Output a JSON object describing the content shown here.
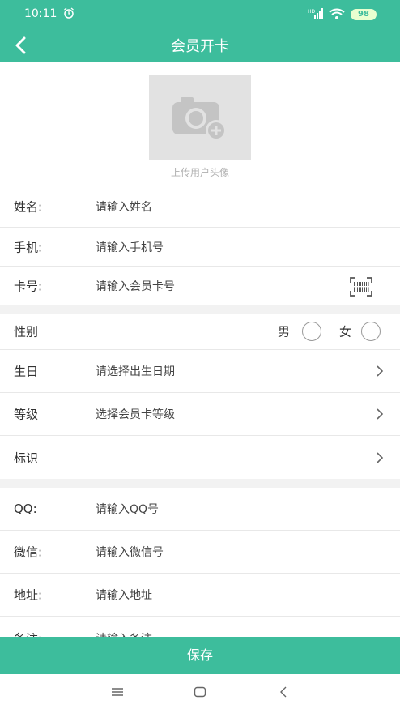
{
  "status": {
    "time": "10:11",
    "signal": "HD",
    "battery": "98"
  },
  "header": {
    "title": "会员开卡"
  },
  "avatar": {
    "caption": "上传用户头像"
  },
  "fields": {
    "name": {
      "label": "姓名:",
      "placeholder": "请输入姓名"
    },
    "phone": {
      "label": "手机:",
      "placeholder": "请输入手机号"
    },
    "card": {
      "label": "卡号:",
      "placeholder": "请输入会员卡号"
    },
    "gender": {
      "label": "性别",
      "male": "男",
      "female": "女"
    },
    "birthday": {
      "label": "生日",
      "placeholder": "请选择出生日期"
    },
    "level": {
      "label": "等级",
      "placeholder": "选择会员卡等级"
    },
    "tag": {
      "label": "标识",
      "placeholder": ""
    },
    "qq": {
      "label": "QQ:",
      "placeholder": "请输入QQ号"
    },
    "wechat": {
      "label": "微信:",
      "placeholder": "请输入微信号"
    },
    "address": {
      "label": "地址:",
      "placeholder": "请输入地址"
    },
    "remark": {
      "label": "备注:",
      "placeholder": "请输入备注"
    }
  },
  "save_label": "保存",
  "colors": {
    "accent": "#3dbd9c"
  }
}
